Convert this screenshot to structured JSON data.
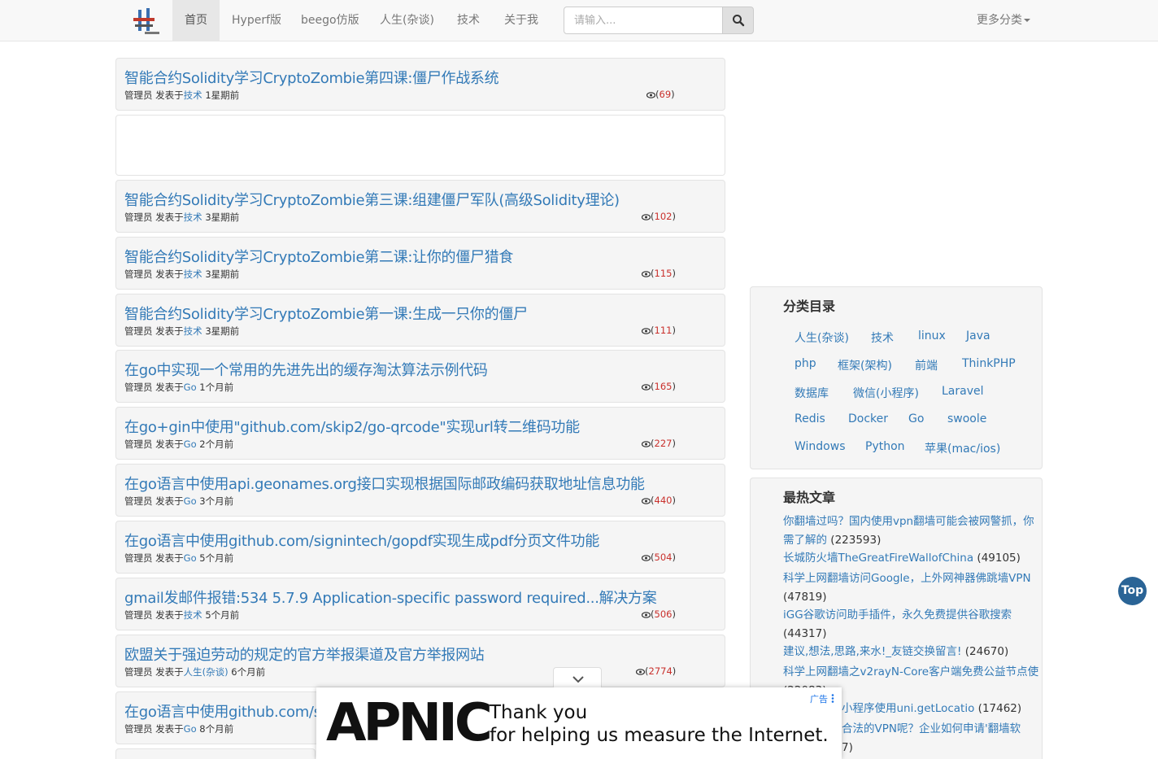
{
  "nav": {
    "items": [
      {
        "label": "首页",
        "active": true
      },
      {
        "label": "Hyperf版",
        "active": false
      },
      {
        "label": "beego仿版",
        "active": false
      },
      {
        "label": "人生(杂谈)",
        "active": false
      },
      {
        "label": "技术",
        "active": false
      },
      {
        "label": "关于我",
        "active": false
      }
    ],
    "search_placeholder": "请输入...",
    "search_icon": "search-icon",
    "more": "更多分类"
  },
  "articles": [
    {
      "title": "智能合约Solidity学习CryptoZombie第四课:僵尸作战系统",
      "author": "管理员",
      "posted_in": "发表于",
      "category": "技术",
      "time": "1星期前",
      "views": "69"
    },
    {
      "title": "智能合约Solidity学习CryptoZombie第三课:组建僵尸军队(高级Solidity理论)",
      "author": "管理员",
      "posted_in": "发表于",
      "category": "技术",
      "time": "3星期前",
      "views": "102"
    },
    {
      "title": "智能合约Solidity学习CryptoZombie第二课:让你的僵尸猎食",
      "author": "管理员",
      "posted_in": "发表于",
      "category": "技术",
      "time": "3星期前",
      "views": "115"
    },
    {
      "title": "智能合约Solidity学习CryptoZombie第一课:生成一只你的僵尸",
      "author": "管理员",
      "posted_in": "发表于",
      "category": "技术",
      "time": "3星期前",
      "views": "111"
    },
    {
      "title": "在go中实现一个常用的先进先出的缓存淘汰算法示例代码",
      "author": "管理员",
      "posted_in": "发表于",
      "category": "Go",
      "time": "1个月前",
      "views": "165"
    },
    {
      "title": "在go+gin中使用\"github.com/skip2/go-qrcode\"实现url转二维码功能",
      "author": "管理员",
      "posted_in": "发表于",
      "category": "Go",
      "time": "2个月前",
      "views": "227"
    },
    {
      "title": "在go语言中使用api.geonames.org接口实现根据国际邮政编码获取地址信息功能",
      "author": "管理员",
      "posted_in": "发表于",
      "category": "Go",
      "time": "3个月前",
      "views": "440"
    },
    {
      "title": "在go语言中使用github.com/signintech/gopdf实现生成pdf分页文件功能",
      "author": "管理员",
      "posted_in": "发表于",
      "category": "Go",
      "time": "5个月前",
      "views": "504"
    },
    {
      "title": "gmail发邮件报错:534 5.7.9 Application-specific password required...解决方案",
      "author": "管理员",
      "posted_in": "发表于",
      "category": "技术",
      "time": "5个月前",
      "views": "506"
    },
    {
      "title": "欧盟关于强迫劳动的规定的官方举报渠道及官方举报网站",
      "author": "管理员",
      "posted_in": "发表于",
      "category": "人生(杂谈)",
      "time": "6个月前",
      "views": "2774"
    },
    {
      "title": "在go语言中使用github.com/si",
      "author": "管理员",
      "posted_in": "发表于",
      "category": "Go",
      "time": "8个月前",
      "views": ""
    }
  ],
  "sidebar": {
    "categories_title": "分类目录",
    "categories": [
      "人生(杂谈)",
      "技术",
      "linux",
      "Java",
      "php",
      "框架(架构)",
      "前端",
      "ThinkPHP",
      "数据库",
      "微信(小程序)",
      "Laravel",
      "Redis",
      "Docker",
      "Go",
      "swoole",
      "Windows",
      "Python",
      "苹果(mac/ios)"
    ],
    "hot_title": "最热文章",
    "hot": [
      {
        "l1": "你翻墙过吗？国内使用vpn翻墙可能会被网警抓，你",
        "l2": "需了解的",
        "count": "(223593)"
      },
      {
        "l1": "长城防火墙TheGreatFireWallofChina",
        "l2": "",
        "count": "(49105)"
      },
      {
        "l1": "科学上网翻墙访问Google，上外网神器佛跳墙VPN",
        "l2": "",
        "count": "(47819)"
      },
      {
        "l1": "iGG谷歌访问助手插件，永久免费提供谷歌搜索",
        "l2": "",
        "count": "(44317)"
      },
      {
        "l1": "建议,想法,思路,来水!_友链交换留言!",
        "l2": "",
        "count": "(24670)"
      },
      {
        "l1": "科学上网翻墙之v2rayN-Core客户端免费公益节点使",
        "l2": "",
        "count": "(22083)"
      },
      {
        "l1": "小程序使用uni.getLocatio",
        "l2": "",
        "count": "(17462)"
      },
      {
        "l1": "合法的VPN呢？企业如何申请'翻墙软",
        "l2": "",
        "count": "7)"
      }
    ]
  },
  "top_button": "Top",
  "ad": {
    "brand": "APNIC",
    "line1": "Thank you",
    "line2": "for helping us measure the Internet.",
    "label": "广告"
  }
}
